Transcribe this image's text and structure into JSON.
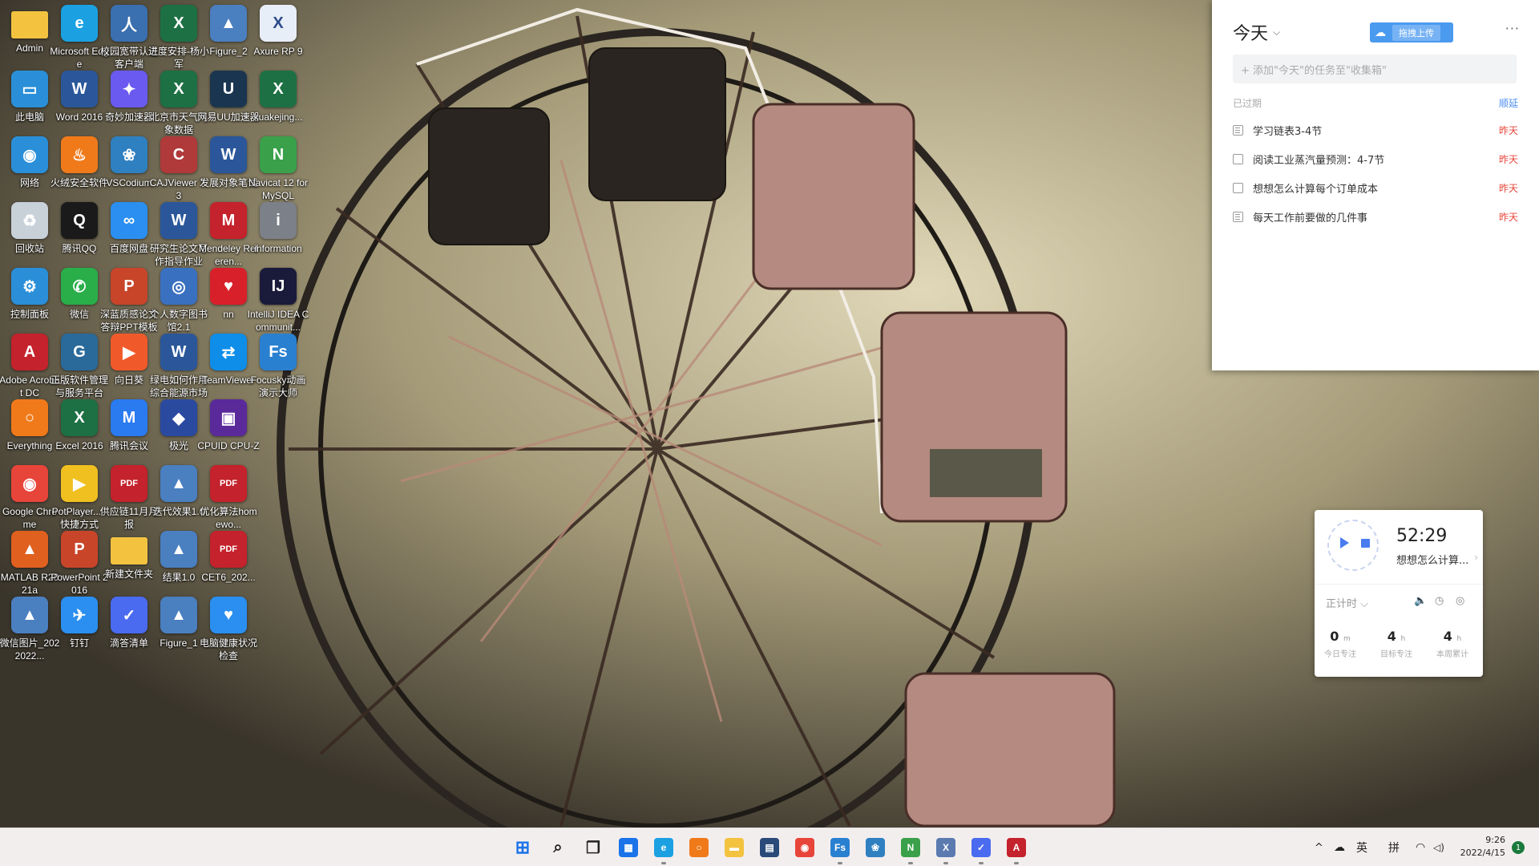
{
  "desktop": {
    "icons": [
      {
        "label": "Admin",
        "glyph": "",
        "color": "#f3c340",
        "icon": "folder-icon"
      },
      {
        "label": "Microsoft Edge",
        "glyph": "e",
        "color": "#1ba1e2",
        "icon": "edge-icon"
      },
      {
        "label": "校园宽带认证客户端",
        "glyph": "人",
        "color": "#3a6fb0",
        "icon": "user-icon"
      },
      {
        "label": "进度安排-杨小军",
        "glyph": "X",
        "color": "#1d7044",
        "icon": "excel-icon"
      },
      {
        "label": "Figure_2",
        "glyph": "▲",
        "color": "#4a7fc0",
        "icon": "image-file-icon"
      },
      {
        "label": "Axure RP 9",
        "glyph": "X",
        "color": "#e8eef8",
        "icon": "axure-icon"
      },
      {
        "label": "此电脑",
        "glyph": "▭",
        "color": "#2a8fd8",
        "icon": "computer-icon"
      },
      {
        "label": "Word 2016",
        "glyph": "W",
        "color": "#2b579a",
        "icon": "word-icon"
      },
      {
        "label": "奇妙加速器",
        "glyph": "✦",
        "color": "#6a5af0",
        "icon": "accelerator-icon"
      },
      {
        "label": "北京市天气气象数据",
        "glyph": "X",
        "color": "#1d7044",
        "icon": "excel-icon"
      },
      {
        "label": "网易UU加速器",
        "glyph": "U",
        "color": "#1a3550",
        "icon": "uu-icon"
      },
      {
        "label": "kuakejing...",
        "glyph": "X",
        "color": "#1d7044",
        "icon": "excel-icon"
      },
      {
        "label": "网络",
        "glyph": "◉",
        "color": "#2a8fd8",
        "icon": "network-icon"
      },
      {
        "label": "火绒安全软件",
        "glyph": "♨",
        "color": "#f07a1a",
        "icon": "huorong-icon"
      },
      {
        "label": "VSCodium",
        "glyph": "❀",
        "color": "#2f80c0",
        "icon": "vscodium-icon"
      },
      {
        "label": "CAJViewer 7.3",
        "glyph": "C",
        "color": "#b03a3a",
        "icon": "cajviewer-icon"
      },
      {
        "label": "发展对象笔试",
        "glyph": "W",
        "color": "#2b579a",
        "icon": "word-icon"
      },
      {
        "label": "Navicat 12 for MySQL",
        "glyph": "N",
        "color": "#3aa04a",
        "icon": "navicat-icon"
      },
      {
        "label": "回收站",
        "glyph": "♻",
        "color": "#c8d0d8",
        "icon": "recycle-bin-icon"
      },
      {
        "label": "腾讯QQ",
        "glyph": "Q",
        "color": "#1a1a1a",
        "icon": "qq-icon"
      },
      {
        "label": "百度网盘",
        "glyph": "∞",
        "color": "#2a8ff0",
        "icon": "baidu-netdisk-icon"
      },
      {
        "label": "研究生论文写作指导作业",
        "glyph": "W",
        "color": "#2b579a",
        "icon": "word-icon"
      },
      {
        "label": "Mendeley Referen...",
        "glyph": "M",
        "color": "#c4222c",
        "icon": "mendeley-icon"
      },
      {
        "label": "information",
        "glyph": "i",
        "color": "#7c8088",
        "icon": "file-icon"
      },
      {
        "label": "控制面板",
        "glyph": "⚙",
        "color": "#2a8fd8",
        "icon": "control-panel-icon"
      },
      {
        "label": "微信",
        "glyph": "✆",
        "color": "#2aae4a",
        "icon": "wechat-icon"
      },
      {
        "label": "深蓝质感论文答辩PPT模板",
        "glyph": "P",
        "color": "#c8452a",
        "icon": "powerpoint-icon"
      },
      {
        "label": "个人数字图书馆2.1",
        "glyph": "◎",
        "color": "#3a70c0",
        "icon": "library-icon"
      },
      {
        "label": "nn",
        "glyph": "♥",
        "color": "#d8202a",
        "icon": "heart-icon"
      },
      {
        "label": "IntelliJ IDEA Communit...",
        "glyph": "IJ",
        "color": "#1a1a3a",
        "icon": "intellij-icon"
      },
      {
        "label": "Adobe Acrobat DC",
        "glyph": "A",
        "color": "#c4222c",
        "icon": "acrobat-icon"
      },
      {
        "label": "正版软件管理与服务平台",
        "glyph": "G",
        "color": "#2a6a9a",
        "icon": "software-platform-icon"
      },
      {
        "label": "向日葵",
        "glyph": "▶",
        "color": "#f05a2a",
        "icon": "sunflower-icon"
      },
      {
        "label": "绿电如何作用综合能源市场",
        "glyph": "W",
        "color": "#2b579a",
        "icon": "word-icon"
      },
      {
        "label": "TeamViewer",
        "glyph": "⇄",
        "color": "#0e8ee9",
        "icon": "teamviewer-icon"
      },
      {
        "label": "Focusky动画演示大师",
        "glyph": "Fs",
        "color": "#2a80d0",
        "icon": "focusky-icon"
      },
      {
        "label": "Everything",
        "glyph": "○",
        "color": "#f07a1a",
        "icon": "search-icon"
      },
      {
        "label": "Excel 2016",
        "glyph": "X",
        "color": "#1d7044",
        "icon": "excel-icon"
      },
      {
        "label": "腾讯会议",
        "glyph": "M",
        "color": "#2a7af0",
        "icon": "tencent-meeting-icon"
      },
      {
        "label": "极光",
        "glyph": "◆",
        "color": "#2a4aa0",
        "icon": "aurora-icon"
      },
      {
        "label": "CPUID CPU-Z",
        "glyph": "▣",
        "color": "#5a2a9a",
        "icon": "cpuz-icon"
      },
      {
        "label": "",
        "glyph": "",
        "color": "transparent",
        "icon": "empty-slot"
      },
      {
        "label": "Google Chrome",
        "glyph": "◉",
        "color": "#e8453a",
        "icon": "chrome-icon"
      },
      {
        "label": "PotPlayer... - 快捷方式",
        "glyph": "▶",
        "color": "#f0c020",
        "icon": "potplayer-icon"
      },
      {
        "label": "供应链11月月报",
        "glyph": "PDF",
        "color": "#c4222c",
        "icon": "pdf-icon"
      },
      {
        "label": "迭代效果1.0",
        "glyph": "▲",
        "color": "#4a7fc0",
        "icon": "image-file-icon"
      },
      {
        "label": "优化算法homewo...",
        "glyph": "PDF",
        "color": "#c4222c",
        "icon": "pdf-icon"
      },
      {
        "label": "",
        "glyph": "",
        "color": "transparent",
        "icon": "empty-slot"
      },
      {
        "label": "MATLAB R2021a",
        "glyph": "▲",
        "color": "#e06020",
        "icon": "matlab-icon"
      },
      {
        "label": "PowerPoint 2016",
        "glyph": "P",
        "color": "#c8452a",
        "icon": "powerpoint-icon"
      },
      {
        "label": "新建文件夹",
        "glyph": "",
        "color": "#f3c340",
        "icon": "folder-icon"
      },
      {
        "label": "结果1.0",
        "glyph": "▲",
        "color": "#4a7fc0",
        "icon": "image-file-icon"
      },
      {
        "label": "CET6_202...",
        "glyph": "PDF",
        "color": "#c4222c",
        "icon": "pdf-icon"
      },
      {
        "label": "",
        "glyph": "",
        "color": "transparent",
        "icon": "empty-slot"
      },
      {
        "label": "微信图片_2022022...",
        "glyph": "▲",
        "color": "#4a7fc0",
        "icon": "image-file-icon"
      },
      {
        "label": "钉钉",
        "glyph": "✈",
        "color": "#2a8ff0",
        "icon": "dingtalk-icon"
      },
      {
        "label": "滴答清单",
        "glyph": "✓",
        "color": "#4a6af0",
        "icon": "ticktick-icon"
      },
      {
        "label": "Figure_1",
        "glyph": "▲",
        "color": "#4a7fc0",
        "icon": "image-file-icon"
      },
      {
        "label": "电脑健康状况检查",
        "glyph": "♥",
        "color": "#2a8ff0",
        "icon": "health-check-icon"
      },
      {
        "label": "",
        "glyph": "",
        "color": "transparent",
        "icon": "empty-slot"
      }
    ]
  },
  "todo": {
    "header": "今天",
    "upload_label": "拖拽上传",
    "more": "···",
    "add_placeholder": "+ 添加\"今天\"的任务至\"收集箱\"",
    "section_title": "已过期",
    "section_action": "顺延",
    "tasks": [
      {
        "text": "学习链表3-4节",
        "due": "昨天",
        "icon": "note"
      },
      {
        "text": "阅读工业蒸汽量预测：4-7节",
        "due": "昨天",
        "icon": "checkbox"
      },
      {
        "text": "想想怎么计算每个订单成本",
        "due": "昨天",
        "icon": "checkbox"
      },
      {
        "text": "每天工作前要做的几件事",
        "due": "昨天",
        "icon": "note"
      }
    ]
  },
  "pomodoro": {
    "time": "52:29",
    "task": "想想怎么计算...",
    "mode": "正计时 ⌵",
    "stats": [
      {
        "num": "0",
        "unit": "m",
        "label": "今日专注"
      },
      {
        "num": "4",
        "unit": "h",
        "label": "目标专注"
      },
      {
        "num": "4",
        "unit": "h",
        "label": "本周累计"
      }
    ]
  },
  "taskbar": {
    "apps": [
      {
        "name": "start-button",
        "glyph": "⊞",
        "color": "#1a73e8",
        "running": false
      },
      {
        "name": "search-button",
        "glyph": "⌕",
        "color": "#222222",
        "running": false
      },
      {
        "name": "task-view-button",
        "glyph": "❐",
        "color": "#222222",
        "running": false
      },
      {
        "name": "widgets-button",
        "glyph": "▦",
        "color": "#1a73e8",
        "running": false
      },
      {
        "name": "edge-app",
        "glyph": "e",
        "color": "#1ba1e2",
        "running": true
      },
      {
        "name": "everything-app",
        "glyph": "○",
        "color": "#f07a1a",
        "running": false
      },
      {
        "name": "file-explorer-app",
        "glyph": "▬",
        "color": "#f3c340",
        "running": false
      },
      {
        "name": "notepad-app",
        "glyph": "▤",
        "color": "#2a4a7a",
        "running": false
      },
      {
        "name": "chrome-app",
        "glyph": "◉",
        "color": "#e8453a",
        "running": false
      },
      {
        "name": "focusky-app",
        "glyph": "Fs",
        "color": "#2a80d0",
        "running": true
      },
      {
        "name": "vscodium-app",
        "glyph": "❀",
        "color": "#2f80c0",
        "running": false
      },
      {
        "name": "navicat-app",
        "glyph": "N",
        "color": "#3aa04a",
        "running": true
      },
      {
        "name": "axure-app",
        "glyph": "X",
        "color": "#5a7ab0",
        "running": true
      },
      {
        "name": "ticktick-app",
        "glyph": "✓",
        "color": "#4a6af0",
        "running": true
      },
      {
        "name": "acrobat-app",
        "glyph": "A",
        "color": "#c4222c",
        "running": true
      }
    ],
    "tray": {
      "chevron": "^",
      "cloud": "☁",
      "lang": "英",
      "ime": "拼",
      "wifi": "◠",
      "volume": "◁)"
    },
    "time": "9:26",
    "date": "2022/4/15",
    "notifications": "1"
  }
}
